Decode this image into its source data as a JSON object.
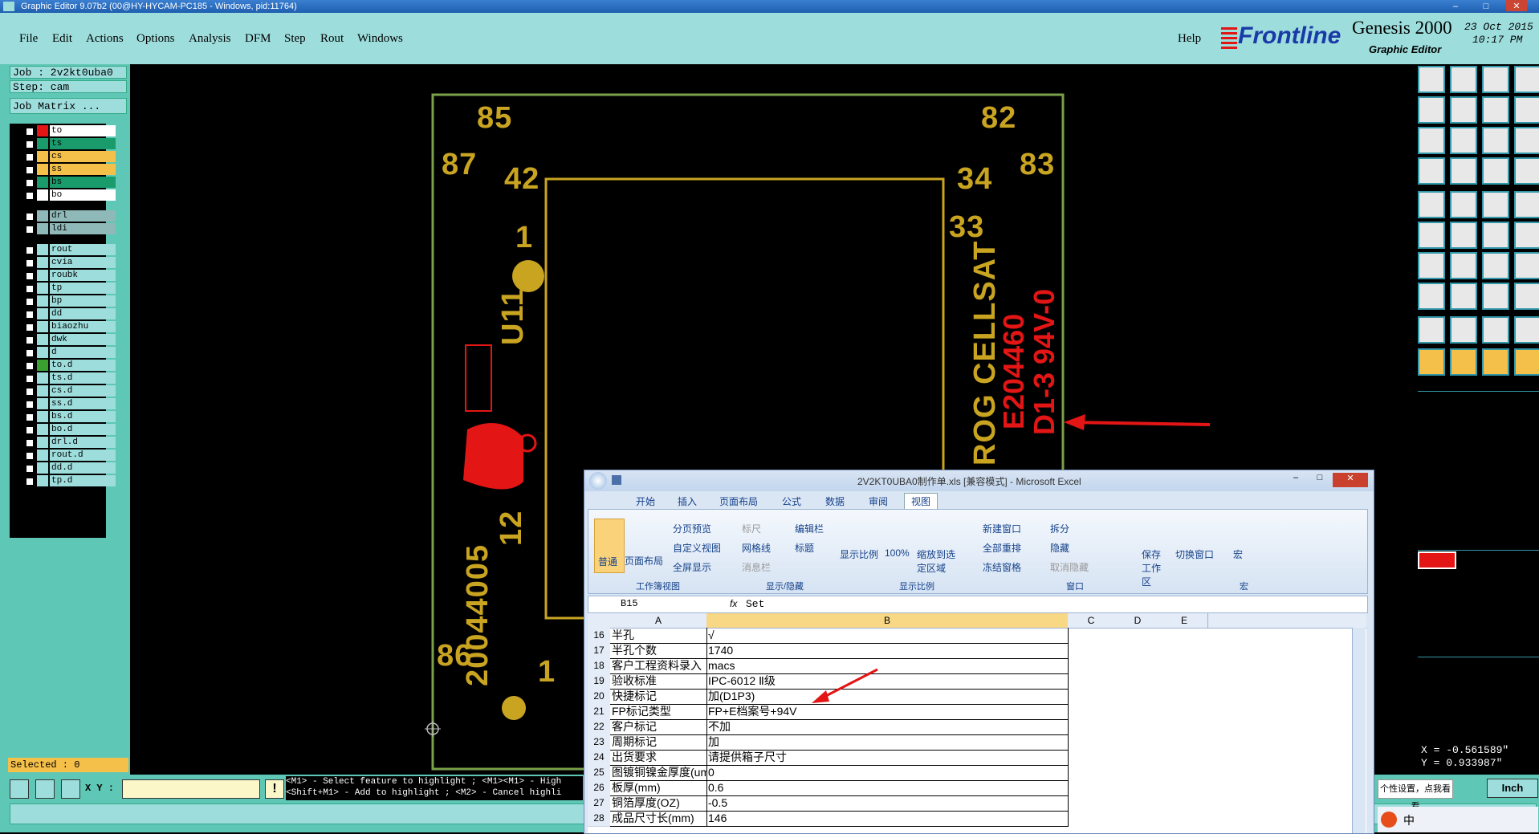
{
  "window": {
    "title": "Graphic Editor 9.07b2 (00@HY-HYCAM-PC185 - Windows, pid:11764)"
  },
  "menu": {
    "items": [
      "File",
      "Edit",
      "Actions",
      "Options",
      "Analysis",
      "DFM",
      "Step",
      "Rout",
      "Windows"
    ],
    "help": "Help"
  },
  "brand": {
    "logo": "Frontline",
    "product": "Genesis 2000",
    "subtitle": "Graphic Editor",
    "date": "23 Oct 2015",
    "time": "10:17 PM"
  },
  "left": {
    "job": "Job : 2v2kt0uba0",
    "step": "Step: cam",
    "job_matrix": "Job Matrix ...",
    "layers": [
      {
        "name": "to",
        "sw": "#e31515",
        "bg": "#ffffff"
      },
      {
        "name": "ts",
        "sw": "#1a9b6c",
        "bg": "#1a9b6c"
      },
      {
        "name": "cs",
        "sw": "#f5c04a",
        "bg": "#f5c04a"
      },
      {
        "name": "ss",
        "sw": "#f5c04a",
        "bg": "#f5c04a"
      },
      {
        "name": "bs",
        "sw": "#1a9b6c",
        "bg": "#1a9b6c"
      },
      {
        "name": "bo",
        "sw": "#ffffff",
        "bg": "#ffffff"
      },
      {
        "name": "drl",
        "sw": "#8fb9b8",
        "bg": "#8fb9b8"
      },
      {
        "name": "ldi",
        "sw": "#8fb9b8",
        "bg": "#8fb9b8"
      },
      {
        "name": "rout",
        "sw": "#9ddedd",
        "bg": "#9ddedd"
      },
      {
        "name": "cvia",
        "sw": "#9ddedd",
        "bg": "#9ddedd"
      },
      {
        "name": "roubk",
        "sw": "#9ddedd",
        "bg": "#9ddedd"
      },
      {
        "name": "tp",
        "sw": "#9ddedd",
        "bg": "#9ddedd"
      },
      {
        "name": "bp",
        "sw": "#9ddedd",
        "bg": "#9ddedd"
      },
      {
        "name": "dd",
        "sw": "#9ddedd",
        "bg": "#9ddedd"
      },
      {
        "name": "biaozhu",
        "sw": "#9ddedd",
        "bg": "#9ddedd"
      },
      {
        "name": "dwk",
        "sw": "#9ddedd",
        "bg": "#9ddedd"
      },
      {
        "name": "d",
        "sw": "#9ddedd",
        "bg": "#9ddedd"
      },
      {
        "name": "to.d",
        "sw": "#3aa030",
        "bg": "#9ddedd"
      },
      {
        "name": "ts.d",
        "sw": "#9ddedd",
        "bg": "#9ddedd"
      },
      {
        "name": "cs.d",
        "sw": "#9ddedd",
        "bg": "#9ddedd"
      },
      {
        "name": "ss.d",
        "sw": "#9ddedd",
        "bg": "#9ddedd"
      },
      {
        "name": "bs.d",
        "sw": "#9ddedd",
        "bg": "#9ddedd"
      },
      {
        "name": "bo.d",
        "sw": "#9ddedd",
        "bg": "#9ddedd"
      },
      {
        "name": "drl.d",
        "sw": "#9ddedd",
        "bg": "#9ddedd"
      },
      {
        "name": "rout.d",
        "sw": "#9ddedd",
        "bg": "#9ddedd"
      },
      {
        "name": "dd.d",
        "sw": "#9ddedd",
        "bg": "#9ddedd"
      },
      {
        "name": "tp.d",
        "sw": "#9ddedd",
        "bg": "#9ddedd"
      }
    ],
    "selected": "Selected : 0"
  },
  "canvas": {
    "labels": [
      "85",
      "82",
      "87",
      "83",
      "42",
      "34",
      "33",
      "1",
      "U11",
      "12",
      "20044005",
      "86",
      "1"
    ],
    "red_text": [
      "ROG CELLSAT",
      "E204460",
      "D1-3 94V-0"
    ]
  },
  "status": {
    "xy_label": "X Y :",
    "hint_line1": "<M1> - Select feature to highlight ; <M1><M1> - High",
    "hint_line2": "<Shift+M1> - Add to highlight ; <M2> - Cancel highli",
    "coord_x": "X = -0.561589\"",
    "coord_y": "Y = 0.933987\"",
    "unit": "Inch",
    "tooltip": "个性设置，点我看看",
    "ime": "中"
  },
  "excel": {
    "title": "2V2KT0UBA0制作单.xls  [兼容模式] - Microsoft Excel",
    "tabs": [
      "开始",
      "插入",
      "页面布局",
      "公式",
      "数据",
      "审阅",
      "视图"
    ],
    "groups": [
      "工作簿视图",
      "显示/隐藏",
      "显示比例",
      "窗口",
      "宏"
    ],
    "ribbon": {
      "normal": "普通",
      "page_layout": "页面布局",
      "page_break": "分页预览",
      "custom_view": "自定义视图",
      "full_screen": "全屏显示",
      "ruler": "标尺",
      "gridlines": "网格线",
      "msgbar": "消息栏",
      "formula_bar": "编辑栏",
      "headings": "标题",
      "zoom": "显示比例",
      "zoom100": "100%",
      "zoom_sel": "缩放到选定区域",
      "new_win": "新建窗口",
      "arrange": "全部重排",
      "freeze": "冻结窗格",
      "split": "拆分",
      "hide": "隐藏",
      "unhide": "取消隐藏",
      "save_ws": "保存工作区",
      "switch_win": "切换窗口",
      "macro": "宏"
    },
    "name_box": "B15",
    "fx": "fx",
    "formula": "Set",
    "columns": [
      "A",
      "B",
      "C",
      "D",
      "E"
    ],
    "rows": [
      {
        "n": "16",
        "a": "半孔",
        "b": "√"
      },
      {
        "n": "17",
        "a": "半孔个数",
        "b": "1740"
      },
      {
        "n": "18",
        "a": "客户工程资料录入",
        "b": "macs"
      },
      {
        "n": "19",
        "a": "验收标准",
        "b": "IPC-6012 Ⅱ级"
      },
      {
        "n": "20",
        "a": "快捷标记",
        "b": "加(D1P3)"
      },
      {
        "n": "21",
        "a": "FP标记类型",
        "b": "FP+E档案号+94V"
      },
      {
        "n": "22",
        "a": "客户标记",
        "b": "不加"
      },
      {
        "n": "23",
        "a": "周期标记",
        "b": "加"
      },
      {
        "n": "24",
        "a": "出货要求",
        "b": "请提供箱子尺寸"
      },
      {
        "n": "25",
        "a": "图镀铜镍金厚度(um)",
        "b": "0"
      },
      {
        "n": "26",
        "a": "板厚(mm)",
        "b": "0.6"
      },
      {
        "n": "27",
        "a": "铜箔厚度(OZ)",
        "b": "-0.5"
      },
      {
        "n": "28",
        "a": "成品尺寸长(mm)",
        "b": "146"
      }
    ]
  }
}
